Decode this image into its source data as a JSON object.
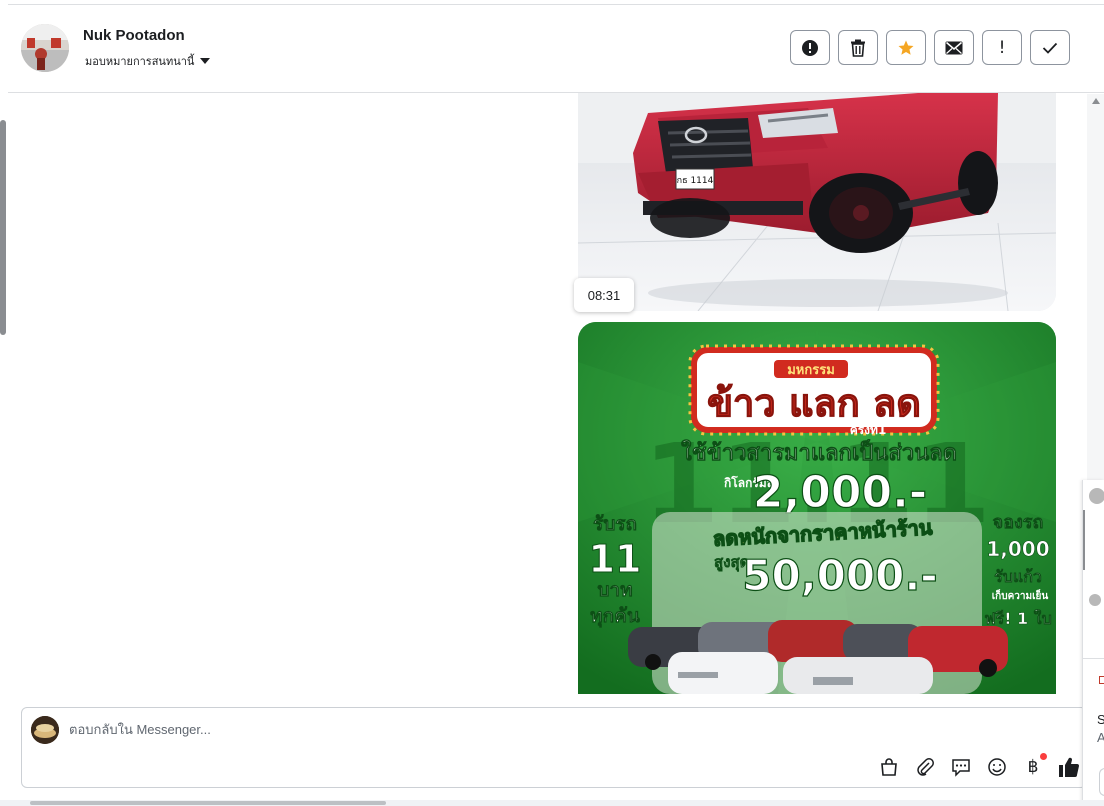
{
  "header": {
    "name": "Nuk Pootadon",
    "assign_label": "มอบหมายการสนทนานี้"
  },
  "toolbar": {
    "items": [
      {
        "id": "report",
        "icon": "alert-circle-icon"
      },
      {
        "id": "delete",
        "icon": "trash-icon"
      },
      {
        "id": "star",
        "icon": "star-icon",
        "color": "#f5a623"
      },
      {
        "id": "mark-unread",
        "icon": "envelope-icon"
      },
      {
        "id": "important",
        "icon": "exclamation-icon",
        "label": "!"
      },
      {
        "id": "done",
        "icon": "check-icon"
      }
    ]
  },
  "messages": {
    "timestamp": "08:31"
  },
  "promo": {
    "small_title": "มหกรรม",
    "big_title": "ข้าว แลก ลด",
    "edition": "ครั้งที่1",
    "line1": "ใช้ข้าวสารมาแลกเป็นส่วนลด",
    "per_kg": "กิโลกรัมละ",
    "price_per_kg": "2,000.-",
    "left_1": "รับรถ",
    "left_2": "11",
    "left_3": "บาท",
    "left_4": "ทุกคัน",
    "right_1": "จองรถ",
    "right_2": "1,000",
    "right_3": "รับแก้ว",
    "right_4": "เก็บความเย็น",
    "right_5": "ฟรี! 1 ใบ",
    "discount_line": "ลดหนักจากราคาหน้าร้าน",
    "max_label": "สูงสุด",
    "max_value": "50,000.-"
  },
  "truck": {
    "plate": "กธ 1114"
  },
  "reply": {
    "placeholder": "ตอบกลับใน Messenger..."
  },
  "reply_tools": [
    "bag-icon",
    "paperclip-icon",
    "saved-reply-icon",
    "emoji-icon",
    "baht-icon",
    "like-icon"
  ],
  "edge": {
    "letter_s": "S",
    "letter_a": "A"
  },
  "colors": {
    "accent_star": "#f5a623",
    "promo_green": "#1e8a2e",
    "like_blue": "#1c1e21"
  }
}
